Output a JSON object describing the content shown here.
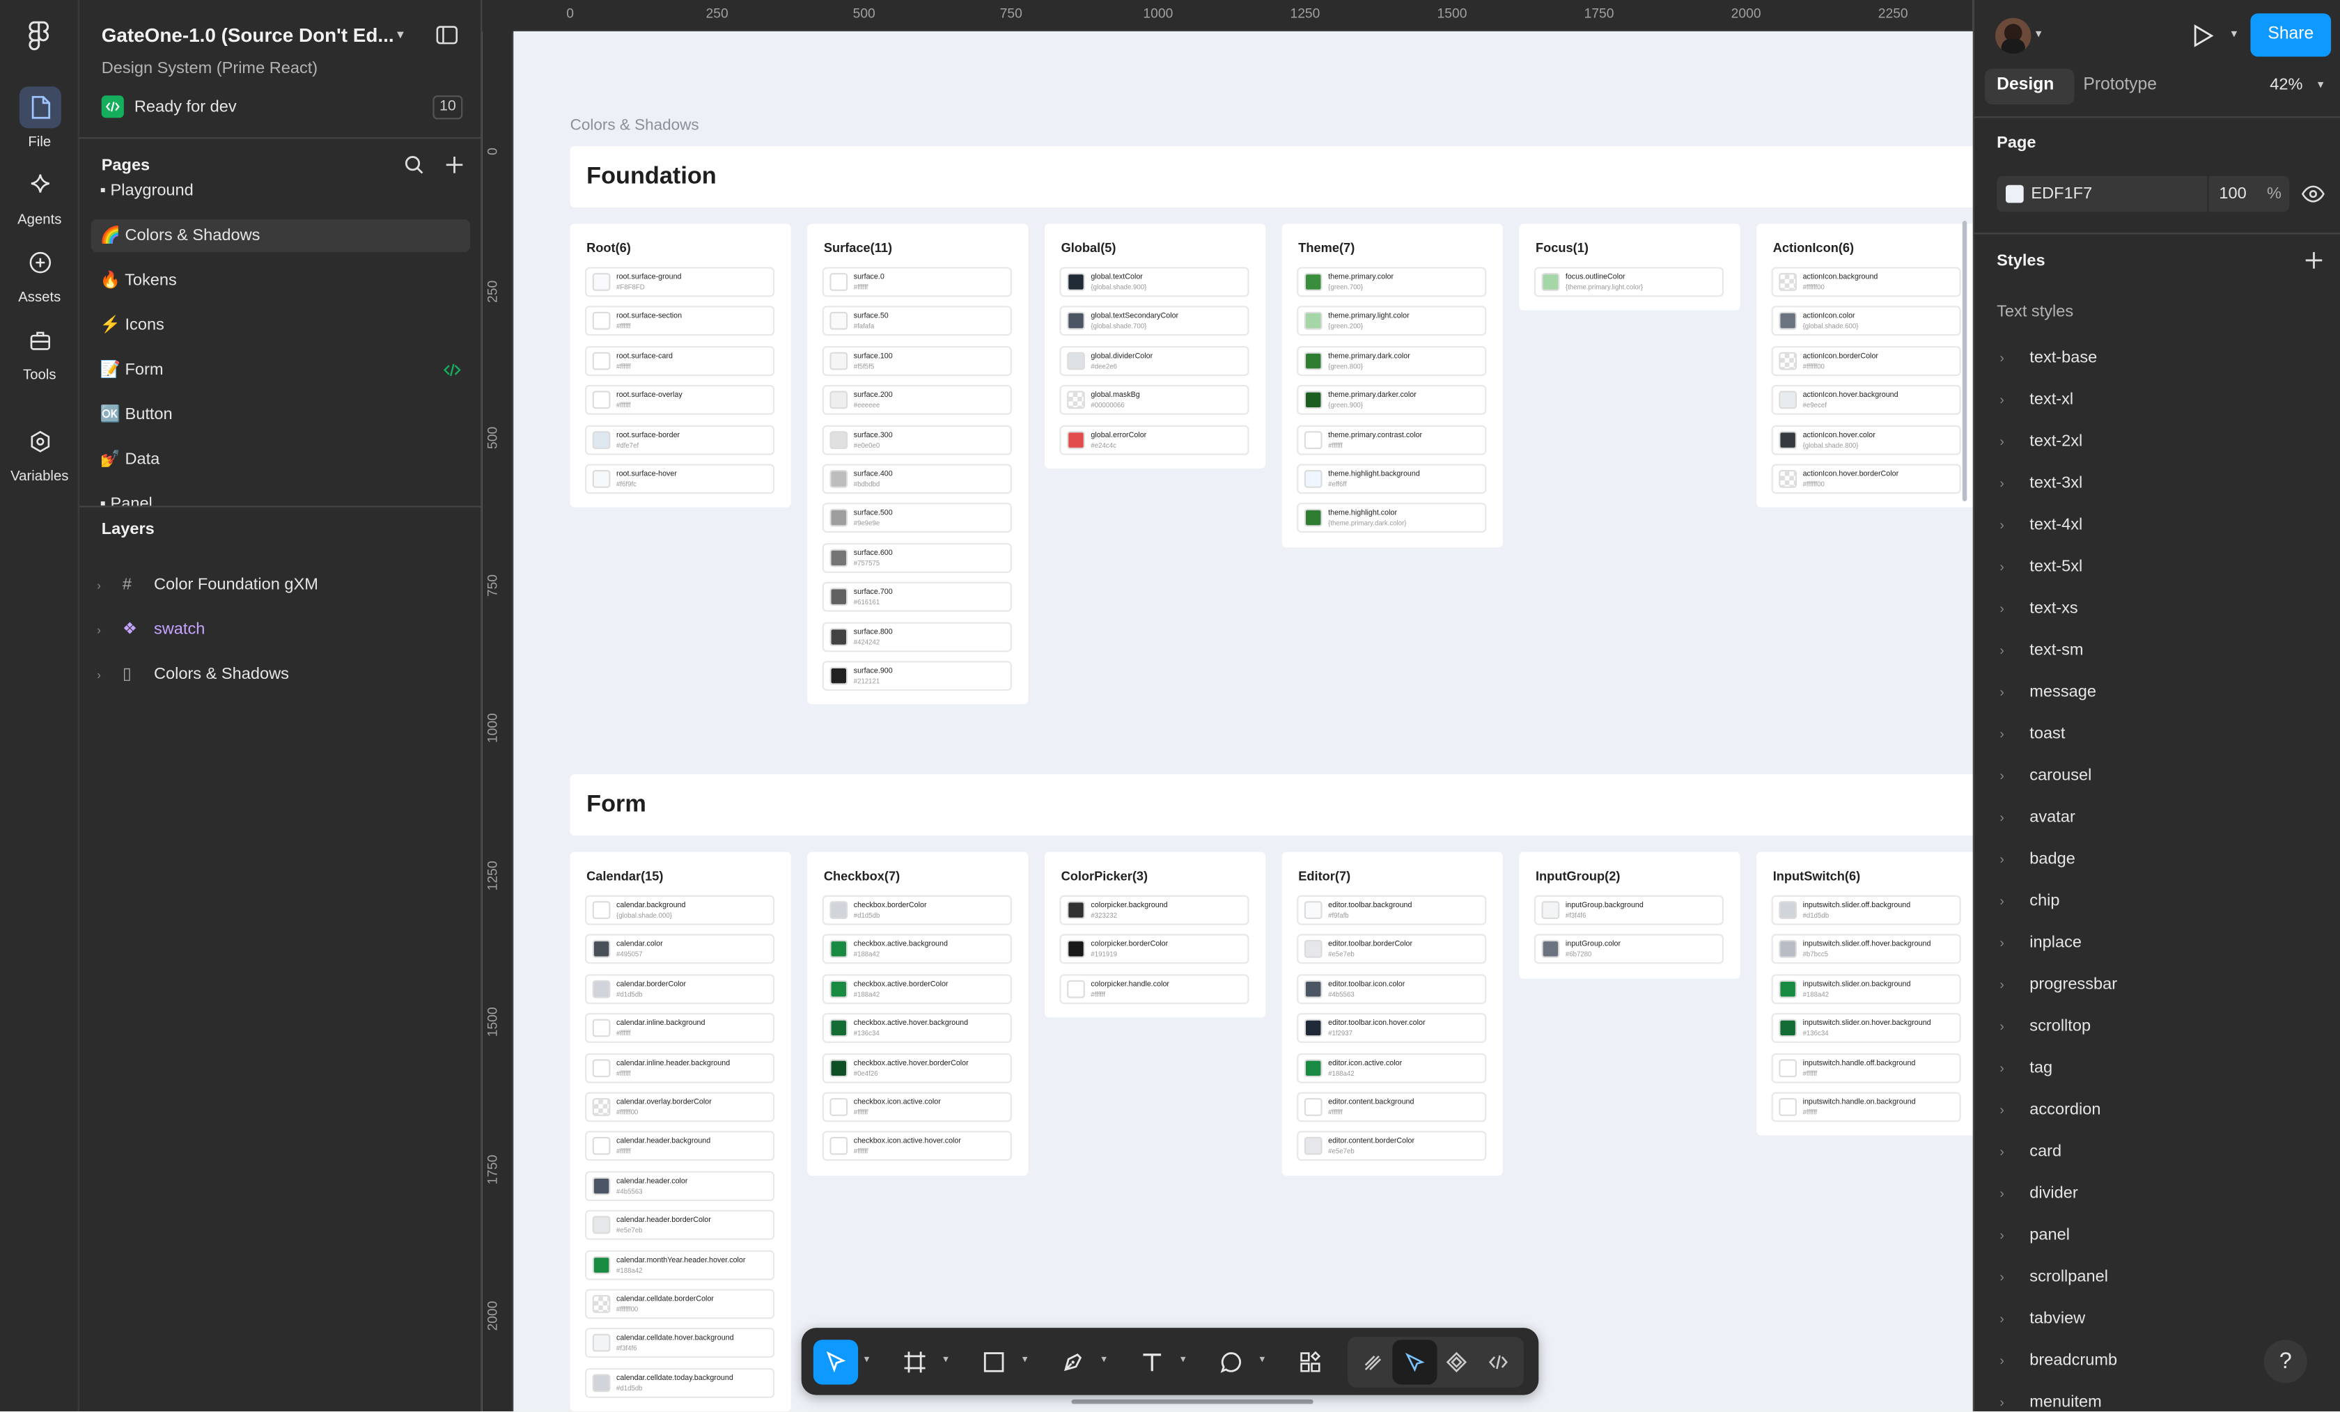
{
  "app": {
    "file_title": "GateOne-1.0 (Source Don't Ed...",
    "project": "Design System (Prime React)",
    "dev_status": "Ready for dev",
    "dev_count": "10"
  },
  "rail": {
    "items": [
      {
        "label": "File",
        "icon": "file-icon"
      },
      {
        "label": "Agents",
        "icon": "sparkle-icon"
      },
      {
        "label": "Assets",
        "icon": "assets-icon"
      },
      {
        "label": "Tools",
        "icon": "toolbox-icon"
      },
      {
        "label": "Variables",
        "icon": "variables-icon"
      }
    ]
  },
  "pages": {
    "heading": "Pages",
    "items": [
      {
        "label": "Playground",
        "emoji": "▪"
      },
      {
        "label": "Colors & Shadows",
        "emoji": "🌈"
      },
      {
        "label": "Tokens",
        "emoji": "🔥"
      },
      {
        "label": "Icons",
        "emoji": "⚡"
      },
      {
        "label": "Form",
        "emoji": "📝"
      },
      {
        "label": "Button",
        "emoji": "🆗"
      },
      {
        "label": "Data",
        "emoji": "💅"
      },
      {
        "label": "Panel",
        "emoji": "▪"
      }
    ]
  },
  "layers": {
    "heading": "Layers",
    "items": [
      {
        "label": "Color Foundation gXM"
      },
      {
        "label": "swatch"
      },
      {
        "label": "Colors & Shadows"
      }
    ]
  },
  "canvas": {
    "frame_label": "Colors & Shadows",
    "ruler_x": [
      "0",
      "250",
      "500",
      "750",
      "1000",
      "1250",
      "1500",
      "1750",
      "2000",
      "2250"
    ],
    "ruler_y": [
      "0",
      "250",
      "500",
      "750",
      "1000",
      "1250",
      "1500",
      "1750",
      "2000"
    ],
    "sections": [
      {
        "title": "Foundation",
        "cards": [
          {
            "title": "Root(6)",
            "swatches": [
              {
                "name": "root.surface-ground",
                "value": "#F8F8FD",
                "color": "#f8f8fd"
              },
              {
                "name": "root.surface-section",
                "value": "#ffffff",
                "color": "#ffffff"
              },
              {
                "name": "root.surface-card",
                "value": "#ffffff",
                "color": "#ffffff"
              },
              {
                "name": "root.surface-overlay",
                "value": "#ffffff",
                "color": "#ffffff"
              },
              {
                "name": "root.surface-border",
                "value": "#dfe7ef",
                "color": "#dfe7ef"
              },
              {
                "name": "root.surface-hover",
                "value": "#f6f9fc",
                "color": "#f6f9fc"
              }
            ]
          },
          {
            "title": "Surface(11)",
            "swatches": [
              {
                "name": "surface.0",
                "value": "#ffffff",
                "color": "#ffffff"
              },
              {
                "name": "surface.50",
                "value": "#fafafa",
                "color": "#fafafa"
              },
              {
                "name": "surface.100",
                "value": "#f5f5f5",
                "color": "#f5f5f5"
              },
              {
                "name": "surface.200",
                "value": "#eeeeee",
                "color": "#eeeeee"
              },
              {
                "name": "surface.300",
                "value": "#e0e0e0",
                "color": "#e0e0e0"
              },
              {
                "name": "surface.400",
                "value": "#bdbdbd",
                "color": "#bdbdbd"
              },
              {
                "name": "surface.500",
                "value": "#9e9e9e",
                "color": "#9e9e9e"
              },
              {
                "name": "surface.600",
                "value": "#757575",
                "color": "#757575"
              },
              {
                "name": "surface.700",
                "value": "#616161",
                "color": "#616161"
              },
              {
                "name": "surface.800",
                "value": "#424242",
                "color": "#424242"
              },
              {
                "name": "surface.900",
                "value": "#212121",
                "color": "#212121"
              }
            ]
          },
          {
            "title": "Global(5)",
            "swatches": [
              {
                "name": "global.textColor",
                "value": "{global.shade.900}",
                "color": "#212b36"
              },
              {
                "name": "global.textSecondaryColor",
                "value": "{global.shade.700}",
                "color": "#4b5563"
              },
              {
                "name": "global.dividerColor",
                "value": "#dee2e6",
                "color": "#dee2e6"
              },
              {
                "name": "global.maskBg",
                "value": "#00000066",
                "color": "checker"
              },
              {
                "name": "global.errorColor",
                "value": "#e24c4c",
                "color": "#e24c4c"
              }
            ]
          },
          {
            "title": "Theme(7)",
            "swatches": [
              {
                "name": "theme.primary.color",
                "value": "{green.700}",
                "color": "#388e3c"
              },
              {
                "name": "theme.primary.light.color",
                "value": "{green.200}",
                "color": "#a5d6a7"
              },
              {
                "name": "theme.primary.dark.color",
                "value": "{green.800}",
                "color": "#2e7d32"
              },
              {
                "name": "theme.primary.darker.color",
                "value": "{green.900}",
                "color": "#1b5e20"
              },
              {
                "name": "theme.primary.contrast.color",
                "value": "#ffffff",
                "color": "#ffffff"
              },
              {
                "name": "theme.highlight.background",
                "value": "#eff6ff",
                "color": "#eff6ff"
              },
              {
                "name": "theme.highlight.color",
                "value": "{theme.primary.dark.color}",
                "color": "#2e7d32"
              }
            ]
          },
          {
            "title": "Focus(1)",
            "swatches": [
              {
                "name": "focus.outlineColor",
                "value": "{theme.primary.light.color}",
                "color": "#a5d6a7"
              }
            ]
          },
          {
            "title": "ActionIcon(6)",
            "swatches": [
              {
                "name": "actionIcon.background",
                "value": "#ffffff00",
                "color": "checker"
              },
              {
                "name": "actionIcon.color",
                "value": "{global.shade.600}",
                "color": "#6b7280"
              },
              {
                "name": "actionIcon.borderColor",
                "value": "#ffffff00",
                "color": "checker"
              },
              {
                "name": "actionIcon.hover.background",
                "value": "#e9ecef",
                "color": "#e9ecef"
              },
              {
                "name": "actionIcon.hover.color",
                "value": "{global.shade.800}",
                "color": "#343a40"
              },
              {
                "name": "actionIcon.hover.borderColor",
                "value": "#ffffff00",
                "color": "checker"
              }
            ]
          }
        ]
      },
      {
        "title": "Form",
        "cards": [
          {
            "title": "Calendar(15)",
            "swatches": [
              {
                "name": "calendar.background",
                "value": "{global.shade.000}",
                "color": "#ffffff"
              },
              {
                "name": "calendar.color",
                "value": "#495057",
                "color": "#495057"
              },
              {
                "name": "calendar.borderColor",
                "value": "#d1d5db",
                "color": "#d1d5db"
              },
              {
                "name": "calendar.inline.background",
                "value": "#ffffff",
                "color": "#ffffff"
              },
              {
                "name": "calendar.inline.header.background",
                "value": "#ffffff",
                "color": "#ffffff"
              },
              {
                "name": "calendar.overlay.borderColor",
                "value": "#ffffff00",
                "color": "checker"
              },
              {
                "name": "calendar.header.background",
                "value": "#ffffff",
                "color": "#ffffff"
              },
              {
                "name": "calendar.header.color",
                "value": "#4b5563",
                "color": "#4b5563"
              },
              {
                "name": "calendar.header.borderColor",
                "value": "#e5e7eb",
                "color": "#e5e7eb"
              },
              {
                "name": "calendar.monthYear.header.hover.color",
                "value": "#188a42",
                "color": "#188a42"
              },
              {
                "name": "calendar.celldate.borderColor",
                "value": "#ffffff00",
                "color": "checker"
              },
              {
                "name": "calendar.celldate.hover.background",
                "value": "#f3f4f6",
                "color": "#f3f4f6"
              },
              {
                "name": "calendar.celldate.today.background",
                "value": "#d1d5db",
                "color": "#d1d5db"
              }
            ]
          },
          {
            "title": "Checkbox(7)",
            "swatches": [
              {
                "name": "checkbox.borderColor",
                "value": "#d1d5db",
                "color": "#d1d5db"
              },
              {
                "name": "checkbox.active.background",
                "value": "#188a42",
                "color": "#188a42"
              },
              {
                "name": "checkbox.active.borderColor",
                "value": "#188a42",
                "color": "#188a42"
              },
              {
                "name": "checkbox.active.hover.background",
                "value": "#136c34",
                "color": "#136c34"
              },
              {
                "name": "checkbox.active.hover.borderColor",
                "value": "#0e4f26",
                "color": "#0e4f26"
              },
              {
                "name": "checkbox.icon.active.color",
                "value": "#ffffff",
                "color": "#ffffff"
              },
              {
                "name": "checkbox.icon.active.hover.color",
                "value": "#ffffff",
                "color": "#ffffff"
              }
            ]
          },
          {
            "title": "ColorPicker(3)",
            "swatches": [
              {
                "name": "colorpicker.background",
                "value": "#323232",
                "color": "#323232"
              },
              {
                "name": "colorpicker.borderColor",
                "value": "#191919",
                "color": "#191919"
              },
              {
                "name": "colorpicker.handle.color",
                "value": "#ffffff",
                "color": "#ffffff"
              }
            ]
          },
          {
            "title": "Editor(7)",
            "swatches": [
              {
                "name": "editor.toolbar.background",
                "value": "#f9fafb",
                "color": "#f9fafb"
              },
              {
                "name": "editor.toolbar.borderColor",
                "value": "#e5e7eb",
                "color": "#e5e7eb"
              },
              {
                "name": "editor.toolbar.icon.color",
                "value": "#4b5563",
                "color": "#4b5563"
              },
              {
                "name": "editor.toolbar.icon.hover.color",
                "value": "#1f2937",
                "color": "#1f2937"
              },
              {
                "name": "editor.icon.active.color",
                "value": "#188a42",
                "color": "#188a42"
              },
              {
                "name": "editor.content.background",
                "value": "#ffffff",
                "color": "#ffffff"
              },
              {
                "name": "editor.content.borderColor",
                "value": "#e5e7eb",
                "color": "#e5e7eb"
              }
            ]
          },
          {
            "title": "InputGroup(2)",
            "swatches": [
              {
                "name": "inputGroup.background",
                "value": "#f3f4f6",
                "color": "#f3f4f6"
              },
              {
                "name": "inputGroup.color",
                "value": "#6b7280",
                "color": "#6b7280"
              }
            ]
          },
          {
            "title": "InputSwitch(6)",
            "swatches": [
              {
                "name": "inputswitch.slider.off.background",
                "value": "#d1d5db",
                "color": "#d1d5db"
              },
              {
                "name": "inputswitch.slider.off.hover.background",
                "value": "#b7bcc5",
                "color": "#b7bcc5"
              },
              {
                "name": "inputswitch.slider.on.background",
                "value": "#188a42",
                "color": "#188a42"
              },
              {
                "name": "inputswitch.slider.on.hover.background",
                "value": "#136c34",
                "color": "#136c34"
              },
              {
                "name": "inputswitch.handle.off.background",
                "value": "#ffffff",
                "color": "#ffffff"
              },
              {
                "name": "inputswitch.handle.on.background",
                "value": "#ffffff",
                "color": "#ffffff"
              }
            ]
          }
        ]
      }
    ]
  },
  "right_panel": {
    "share_label": "Share",
    "tabs": [
      "Design",
      "Prototype"
    ],
    "zoom": "42%",
    "page_heading": "Page",
    "page_color": "EDF1F7",
    "page_opacity": "100",
    "percent_sign": "%",
    "styles_heading": "Styles",
    "text_styles_heading": "Text styles",
    "text_styles": [
      "text-base",
      "text-xl",
      "text-2xl",
      "text-3xl",
      "text-4xl",
      "text-5xl",
      "text-xs",
      "text-sm",
      "message",
      "toast",
      "carousel",
      "avatar",
      "badge",
      "chip",
      "inplace",
      "progressbar",
      "scrolltop",
      "tag",
      "accordion",
      "card",
      "divider",
      "panel",
      "scrollpanel",
      "tabview",
      "breadcrumb",
      "menuitem"
    ]
  },
  "help_label": "?",
  "colors": {
    "accent": "#0d99ff",
    "dev_green": "#14ae5c",
    "panel_bg": "#2c2c2c",
    "canvas_bg": "#edf1f7",
    "component_purple": "#c7a4ff"
  }
}
